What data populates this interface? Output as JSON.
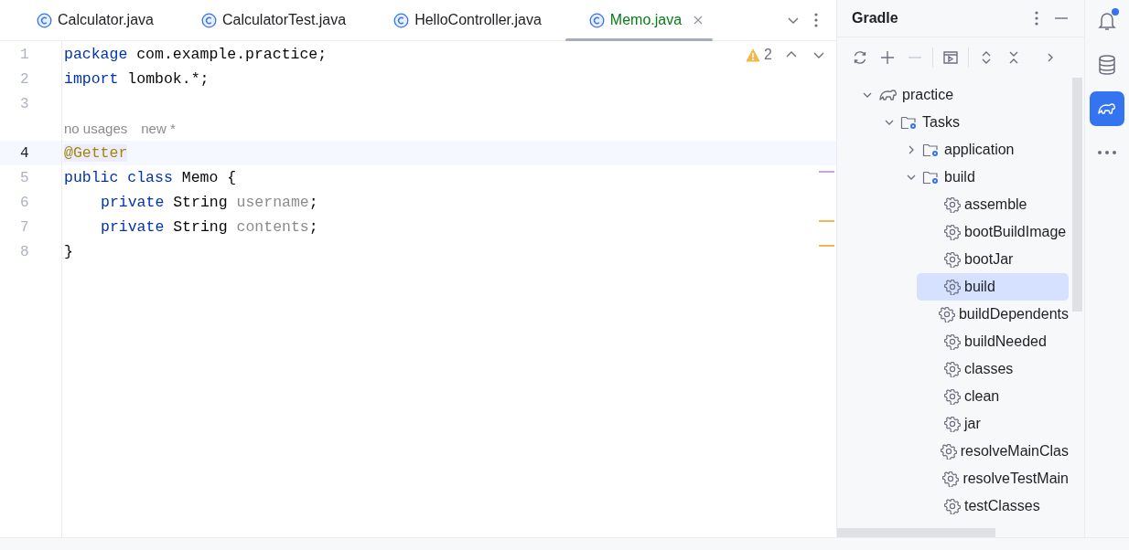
{
  "tabs": [
    {
      "label": "Calculator.java",
      "selected": false
    },
    {
      "label": "CalculatorTest.java",
      "selected": false
    },
    {
      "label": "HelloController.java",
      "selected": false
    },
    {
      "label": "Memo.java",
      "selected": true
    }
  ],
  "editor": {
    "warnings": "2",
    "lines": [
      {
        "number": "1",
        "current": false,
        "tokens": [
          {
            "kind": "keyword",
            "text": "package"
          },
          {
            "kind": "plain",
            "text": " com.example.practice;"
          }
        ]
      },
      {
        "number": "2",
        "current": false,
        "tokens": [
          {
            "kind": "keyword",
            "text": "import"
          },
          {
            "kind": "plain",
            "text": " lombok.*;"
          }
        ]
      },
      {
        "number": "3",
        "current": false
      },
      {
        "kind": "hint",
        "texts": [
          "no usages",
          "new *"
        ]
      },
      {
        "number": "4",
        "current": true,
        "tokens": [
          {
            "kind": "annotation",
            "text": "@Getter"
          }
        ]
      },
      {
        "number": "5",
        "current": false,
        "color": "#c9a0f5",
        "tokens": [
          {
            "kind": "keyword",
            "text": "public class"
          },
          {
            "kind": "plain",
            "text": " Memo {"
          }
        ]
      },
      {
        "number": "6",
        "current": false,
        "indented": true,
        "tokens": [
          {
            "kind": "keyword",
            "text": "private"
          },
          {
            "kind": "plain",
            "text": " String "
          },
          {
            "kind": "field",
            "text": "username"
          },
          {
            "kind": "plain",
            "text": ";"
          }
        ]
      },
      {
        "number": "7",
        "current": false,
        "color": "#f0b84f",
        "indented": true,
        "tokens": [
          {
            "kind": "keyword",
            "text": "private"
          },
          {
            "kind": "plain",
            "text": " String "
          },
          {
            "kind": "field",
            "text": "contents"
          },
          {
            "kind": "plain",
            "text": ";"
          }
        ]
      },
      {
        "number": "8",
        "current": false,
        "color": "#f0b84f",
        "tokens": [
          {
            "kind": "plain",
            "text": "}"
          }
        ]
      }
    ]
  },
  "gradle": {
    "title": "Gradle",
    "tree": [
      {
        "label": "practice",
        "kind": "project",
        "expanded": true,
        "selected": false,
        "children": [
          {
            "label": "Tasks",
            "kind": "folder",
            "expanded": true,
            "selected": false,
            "children": [
              {
                "label": "application",
                "kind": "folder",
                "expanded": false,
                "selected": false
              },
              {
                "label": "build",
                "kind": "folder",
                "expanded": true,
                "selected": false,
                "children": [
                  {
                    "label": "assemble",
                    "kind": "task",
                    "selected": false
                  },
                  {
                    "label": "bootBuildImage",
                    "kind": "task",
                    "selected": false
                  },
                  {
                    "label": "bootJar",
                    "kind": "task",
                    "selected": false
                  },
                  {
                    "label": "build",
                    "kind": "task",
                    "selected": true
                  },
                  {
                    "label": "buildDependents",
                    "kind": "task",
                    "selected": false
                  },
                  {
                    "label": "buildNeeded",
                    "kind": "task",
                    "selected": false
                  },
                  {
                    "label": "classes",
                    "kind": "task",
                    "selected": false
                  },
                  {
                    "label": "clean",
                    "kind": "task",
                    "selected": false
                  },
                  {
                    "label": "jar",
                    "kind": "task",
                    "selected": false
                  },
                  {
                    "label": "resolveMainClas",
                    "kind": "task",
                    "selected": false
                  },
                  {
                    "label": "resolveTestMain",
                    "kind": "task",
                    "selected": false
                  },
                  {
                    "label": "testClasses",
                    "kind": "task",
                    "selected": false
                  }
                ]
              }
            ]
          }
        ]
      }
    ]
  },
  "tool_strip": [
    {
      "kind": "notifications",
      "selected": false,
      "badge": true
    },
    {
      "kind": "database",
      "selected": false
    },
    {
      "kind": "gradle",
      "selected": true
    },
    {
      "kind": "more",
      "selected": false
    }
  ]
}
